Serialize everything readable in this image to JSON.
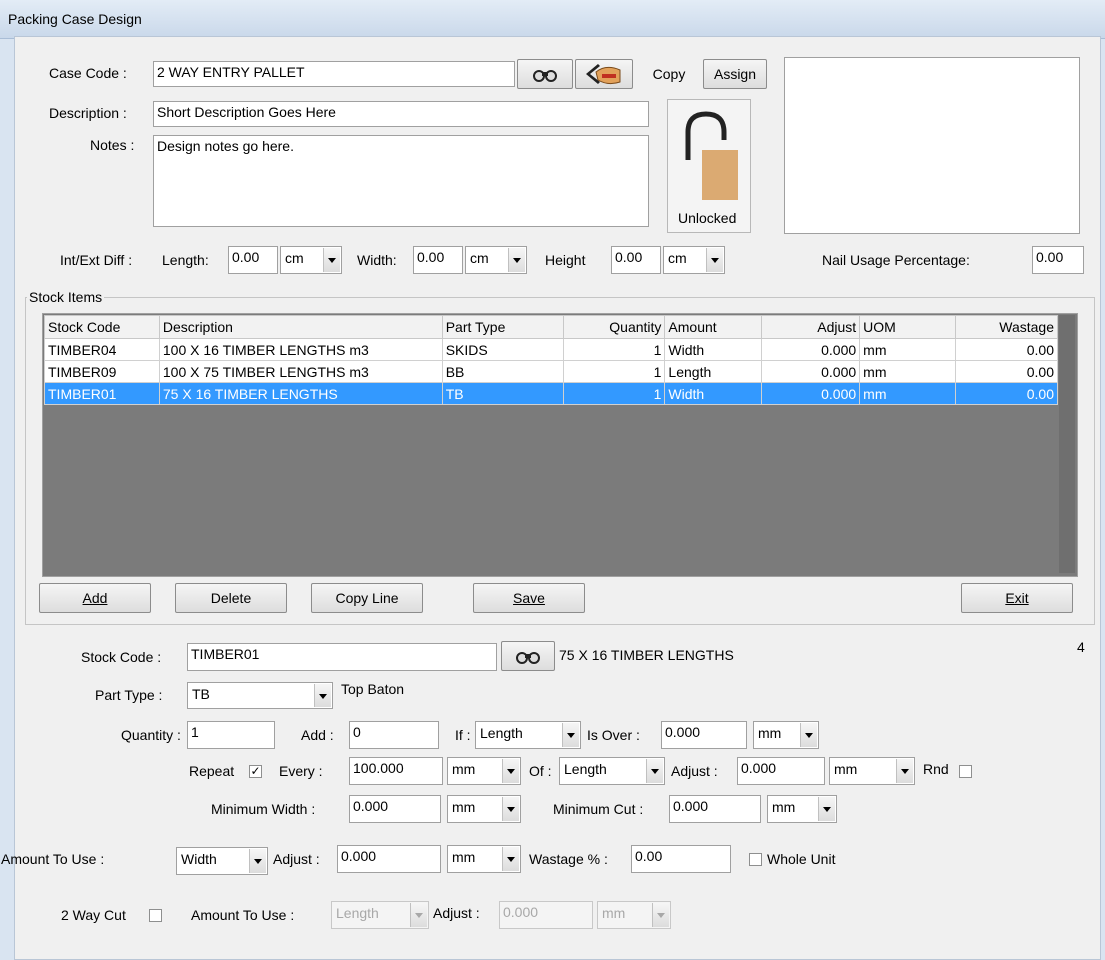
{
  "window": {
    "title": "Packing Case Design"
  },
  "header": {
    "case_code_label": "Case Code :",
    "case_code": "2 WAY ENTRY PALLET",
    "copy_label": "Copy",
    "assign_label": "Assign",
    "description_label": "Description :",
    "description": "Short Description Goes Here",
    "notes_label": "Notes :",
    "notes": "Design notes go here.",
    "lock_status": "Unlocked"
  },
  "dimensions": {
    "intext_label": "Int/Ext Diff :",
    "length_label": "Length:",
    "length_value": "0.00",
    "length_unit": "cm",
    "width_label": "Width:",
    "width_value": "0.00",
    "width_unit": "cm",
    "height_label": "Height",
    "height_value": "0.00",
    "height_unit": "cm",
    "nail_label": "Nail Usage Percentage:",
    "nail_value": "0.00"
  },
  "stock_items": {
    "group_label": "Stock Items",
    "columns": [
      "Stock Code",
      "Description",
      "Part Type",
      "Quantity",
      "Amount",
      "Adjust",
      "UOM",
      "Wastage"
    ],
    "rows": [
      {
        "code": "TIMBER04",
        "description": "100 X 16 TIMBER LENGTHS m3",
        "part_type": "SKIDS",
        "quantity": "1",
        "amount": "Width",
        "adjust": "0.000",
        "uom": "mm",
        "wastage": "0.00"
      },
      {
        "code": "TIMBER09",
        "description": "100 X 75 TIMBER LENGTHS m3",
        "part_type": "BB",
        "quantity": "1",
        "amount": "Length",
        "adjust": "0.000",
        "uom": "mm",
        "wastage": "0.00"
      },
      {
        "code": "TIMBER01",
        "description": "75 X 16 TIMBER LENGTHS",
        "part_type": "TB",
        "quantity": "1",
        "amount": "Width",
        "adjust": "0.000",
        "uom": "mm",
        "wastage": "0.00"
      }
    ],
    "buttons": {
      "add": "Add",
      "delete": "Delete",
      "copy_line": "Copy Line",
      "save": "Save",
      "exit": "Exit"
    },
    "count": "4"
  },
  "detail": {
    "stock_code_label": "Stock Code :",
    "stock_code": "TIMBER01",
    "stock_desc": "75 X 16 TIMBER LENGTHS",
    "part_type_label": "Part Type :",
    "part_type": "TB",
    "part_type_desc": "Top Baton",
    "quantity_label": "Quantity :",
    "quantity": "1",
    "add_label": "Add :",
    "add": "0",
    "if_label": "If :",
    "if_value": "Length",
    "is_over_label": "Is Over :",
    "is_over": "0.000",
    "is_over_unit": "mm",
    "repeat_label": "Repeat",
    "repeat_checked": "✓",
    "every_label": "Every :",
    "every": "100.000",
    "every_unit": "mm",
    "of_label": "Of :",
    "of_value": "Length",
    "adjust_label": "Adjust :",
    "adjust": "0.000",
    "adjust_unit": "mm",
    "rnd_label": "Rnd",
    "min_width_label": "Minimum Width :",
    "min_width": "0.000",
    "min_width_unit": "mm",
    "min_cut_label": "Minimum Cut :",
    "min_cut": "0.000",
    "min_cut_unit": "mm",
    "amount_label": "Amount To Use :",
    "amount": "Width",
    "amount_adjust_label": "Adjust :",
    "amount_adjust": "0.000",
    "amount_adjust_unit": "mm",
    "wastage_label": "Wastage % :",
    "wastage": "0.00",
    "whole_unit_label": "Whole Unit",
    "two_way_label": "2 Way Cut",
    "amount2_label": "Amount To Use :",
    "amount2": "Length",
    "adjust2_label": "Adjust :",
    "adjust2": "0.000",
    "adjust2_unit": "mm"
  }
}
